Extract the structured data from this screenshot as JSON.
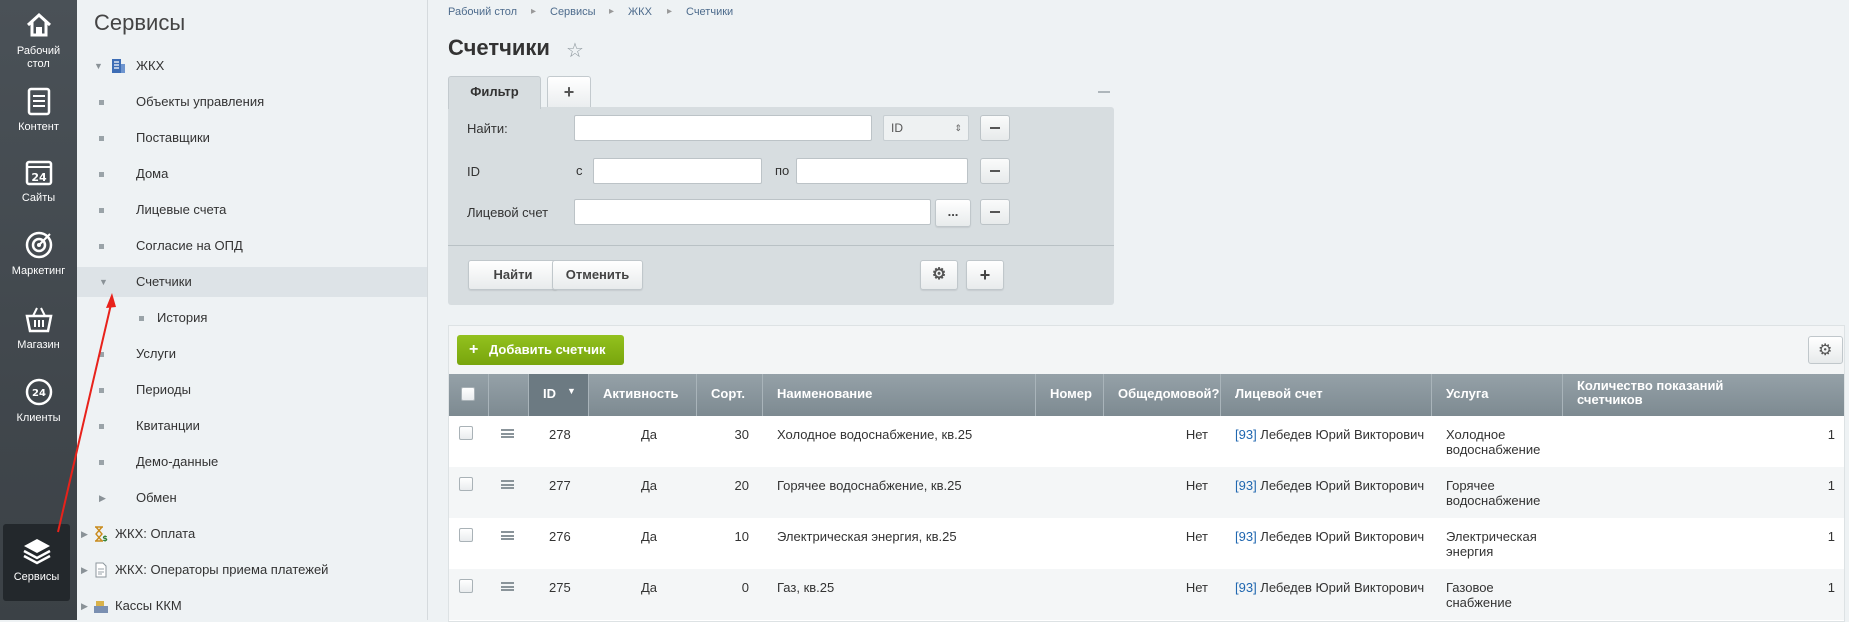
{
  "leftbar": {
    "items": [
      {
        "label_l1": "Рабочий",
        "label_l2": "стол",
        "icon": "home-icon"
      },
      {
        "label_l1": "Контент",
        "icon": "document-icon"
      },
      {
        "label_l1": "Сайты",
        "icon": "calendar-24-icon"
      },
      {
        "label_l1": "Маркетинг",
        "icon": "target-icon"
      },
      {
        "label_l1": "Магазин",
        "icon": "basket-icon"
      },
      {
        "label_l1": "Клиенты",
        "icon": "crm-24-icon"
      },
      {
        "label_l1": "Сервисы",
        "icon": "layers-icon",
        "active": true
      }
    ]
  },
  "menu": {
    "title": "Сервисы",
    "items": [
      {
        "label": "ЖКХ"
      },
      {
        "label": "Объекты управления"
      },
      {
        "label": "Поставщики"
      },
      {
        "label": "Дома"
      },
      {
        "label": "Лицевые счета"
      },
      {
        "label": "Согласие на ОПД"
      },
      {
        "label": "Счетчики"
      },
      {
        "label": "История"
      },
      {
        "label": "Услуги"
      },
      {
        "label": "Периоды"
      },
      {
        "label": "Квитанции"
      },
      {
        "label": "Демо-данные"
      },
      {
        "label": "Обмен"
      },
      {
        "label": "ЖКХ: Оплата"
      },
      {
        "label": "ЖКХ: Операторы приема платежей"
      },
      {
        "label": "Кассы ККМ"
      }
    ]
  },
  "breadcrumb": [
    "Рабочий стол",
    "Сервисы",
    "ЖКХ",
    "Счетчики"
  ],
  "page_title": "Счетчики",
  "filter": {
    "tab_label": "Фильтр",
    "find_label": "Найти:",
    "find_value": "",
    "find_scope": "ID",
    "id_label": "ID",
    "from_label": "с",
    "to_label": "по",
    "account_label": "Лицевой счет",
    "ellipsis": "...",
    "find_button": "Найти",
    "cancel_button": "Отменить"
  },
  "grid": {
    "add_button": "Добавить счетчик",
    "columns": [
      "ID",
      "Активность",
      "Сорт.",
      "Наименование",
      "Номер",
      "Общедомовой?",
      "Лицевой счет",
      "Услуга",
      "Количество показаний счетчиков"
    ],
    "rows": [
      {
        "id": "278",
        "active": "Да",
        "sort": "30",
        "name": "Холодное водоснабжение, кв.25",
        "number": "",
        "common": "Нет",
        "acc_id": "[93]",
        "acc_name": " Лебедев Юрий Викторович",
        "service": "Холодное водоснабжение",
        "count": "1"
      },
      {
        "id": "277",
        "active": "Да",
        "sort": "20",
        "name": "Горячее водоснабжение, кв.25",
        "number": "",
        "common": "Нет",
        "acc_id": "[93]",
        "acc_name": " Лебедев Юрий Викторович",
        "service": "Горячее водоснабжение",
        "count": "1"
      },
      {
        "id": "276",
        "active": "Да",
        "sort": "10",
        "name": "Электрическая энергия, кв.25",
        "number": "",
        "common": "Нет",
        "acc_id": "[93]",
        "acc_name": " Лебедев Юрий Викторович",
        "service": "Электрическая энергия",
        "count": "1"
      },
      {
        "id": "275",
        "active": "Да",
        "sort": "0",
        "name": "Газ, кв.25",
        "number": "",
        "common": "Нет",
        "acc_id": "[93]",
        "acc_name": " Лебедев Юрий Викторович",
        "service": "Газовое снабжение",
        "count": "1"
      }
    ]
  },
  "colors": {
    "annotation_arrow": "#e8221b",
    "add_button": "#86b318",
    "link": "#2067b0"
  }
}
